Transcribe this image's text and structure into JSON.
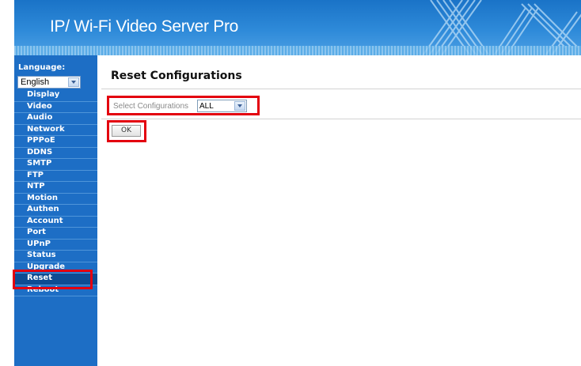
{
  "header": {
    "title": "IP/ Wi-Fi Video Server Pro"
  },
  "sidebar": {
    "language_label": "Language:",
    "language_value": "English",
    "items": [
      {
        "label": "Display"
      },
      {
        "label": "Video"
      },
      {
        "label": "Audio"
      },
      {
        "label": "Network"
      },
      {
        "label": "PPPoE"
      },
      {
        "label": "DDNS"
      },
      {
        "label": "SMTP"
      },
      {
        "label": "FTP"
      },
      {
        "label": "NTP"
      },
      {
        "label": "Motion"
      },
      {
        "label": "Authen"
      },
      {
        "label": "Account"
      },
      {
        "label": "Port"
      },
      {
        "label": "UPnP"
      },
      {
        "label": "Status"
      },
      {
        "label": "Upgrade"
      },
      {
        "label": "Reset"
      },
      {
        "label": "Reboot"
      }
    ],
    "active_item": "Reset"
  },
  "main": {
    "title": "Reset Configurations",
    "select_label": "Select Configurations",
    "select_value": "ALL",
    "ok_label": "OK"
  },
  "colors": {
    "banner": "#2e8ad9",
    "sidebar": "#1d6ec5",
    "highlight": "#e3000f"
  }
}
